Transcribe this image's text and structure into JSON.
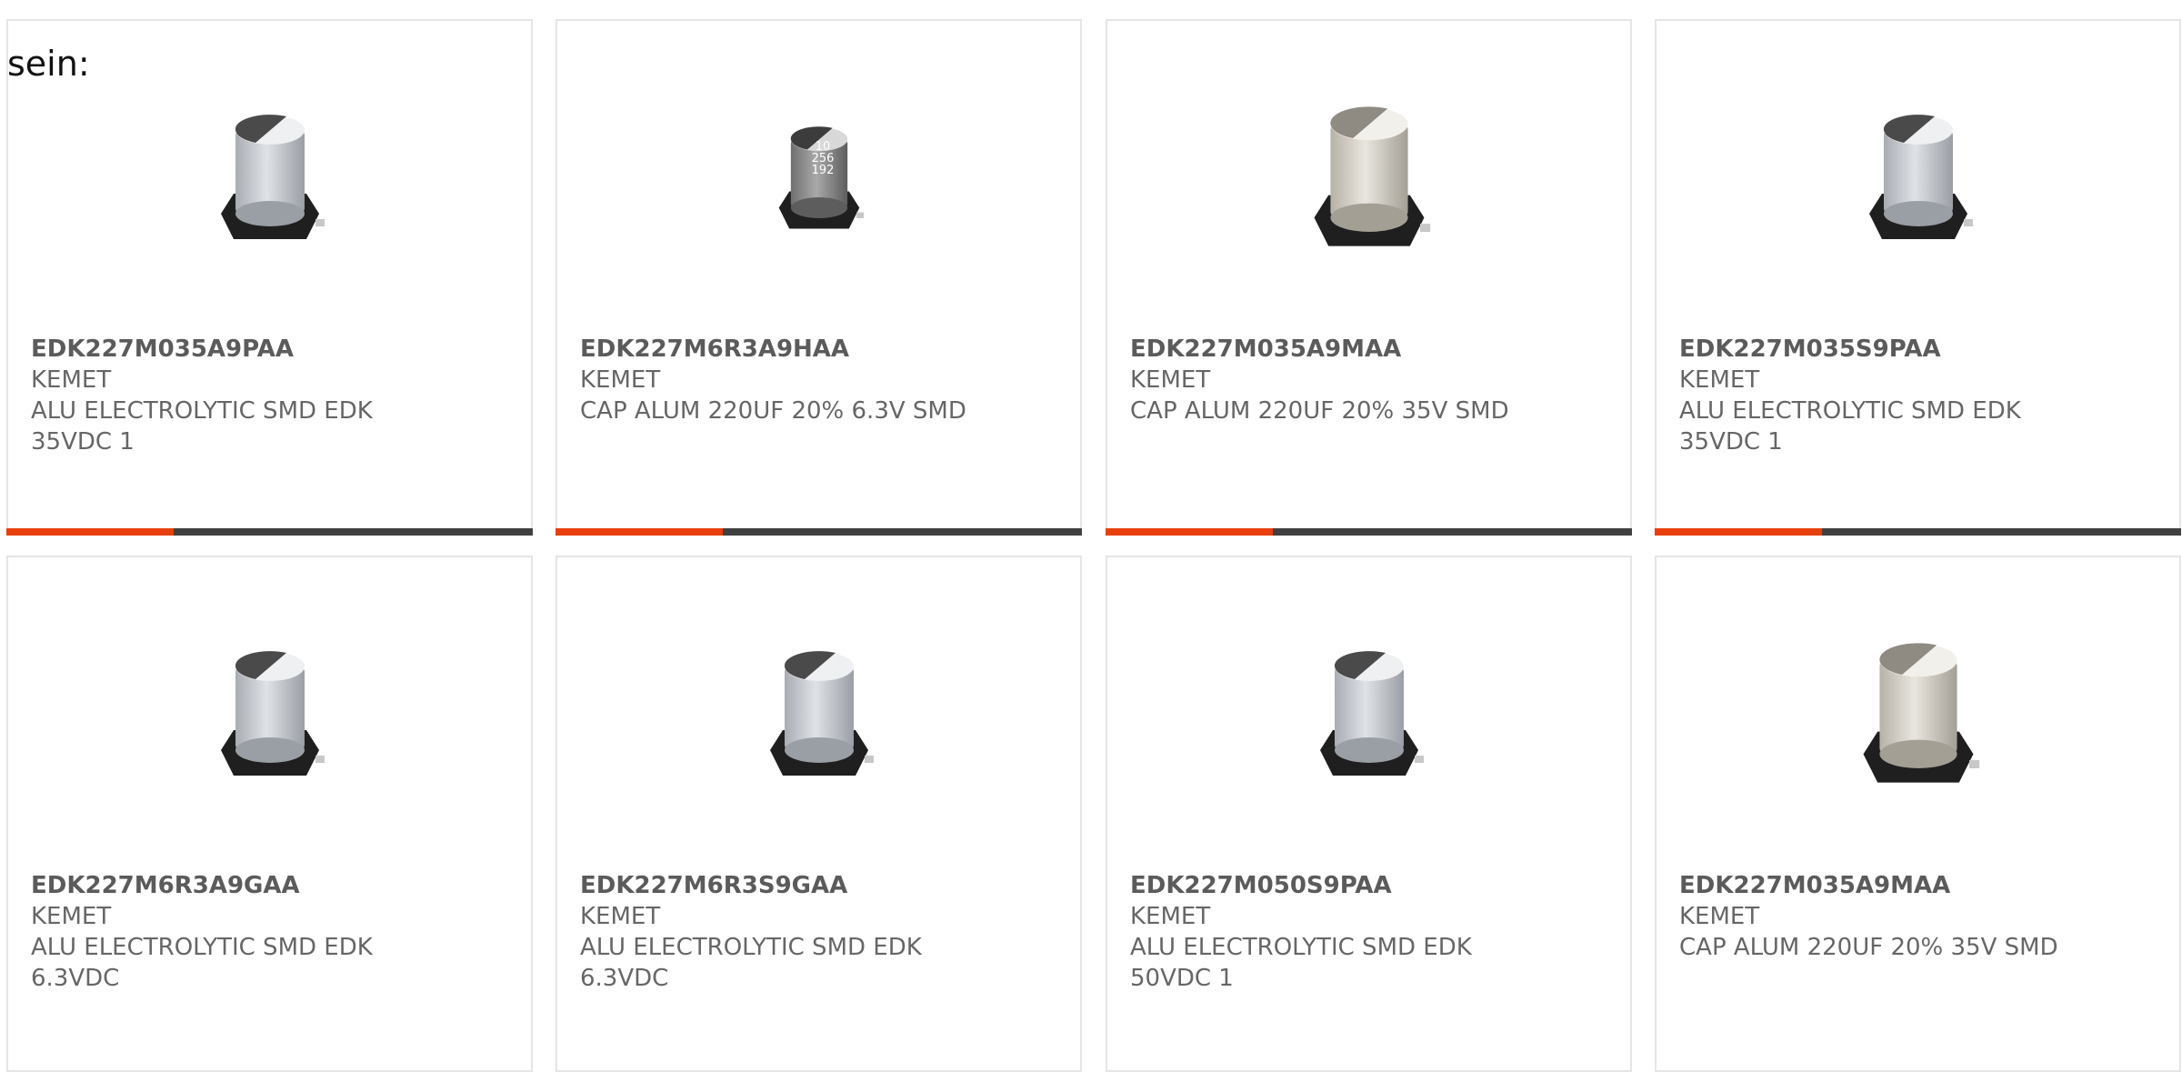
{
  "intro_text": "sein:",
  "colors": {
    "accent": "#e8400c",
    "bar_dark": "#404040",
    "text": "#666666",
    "border": "#e5e5e5"
  },
  "products": [
    {
      "part_number": "EDK227M035A9PAA",
      "manufacturer": "KEMET",
      "description": "ALU ELECTROLYTIC SMD EDK\n35VDC 1",
      "image": "capacitor-grey-icon"
    },
    {
      "part_number": "EDK227M6R3A9HAA",
      "manufacturer": "KEMET",
      "description": "CAP ALUM 220UF 20% 6.3V SMD",
      "image": "capacitor-dark-marked-icon",
      "image_marking": "10\n256\n192"
    },
    {
      "part_number": "EDK227M035A9MAA",
      "manufacturer": "KEMET",
      "description": "CAP ALUM 220UF 20% 35V SMD",
      "image": "capacitor-silver-icon"
    },
    {
      "part_number": "EDK227M035S9PAA",
      "manufacturer": "KEMET",
      "description": "ALU ELECTROLYTIC SMD EDK\n35VDC 1",
      "image": "capacitor-grey-icon"
    },
    {
      "part_number": "EDK227M6R3A9GAA",
      "manufacturer": "KEMET",
      "description": "ALU ELECTROLYTIC SMD EDK\n6.3VDC",
      "image": "capacitor-grey-icon"
    },
    {
      "part_number": "EDK227M6R3S9GAA",
      "manufacturer": "KEMET",
      "description": "ALU ELECTROLYTIC SMD EDK\n6.3VDC",
      "image": "capacitor-grey-icon"
    },
    {
      "part_number": "EDK227M050S9PAA",
      "manufacturer": "KEMET",
      "description": "ALU ELECTROLYTIC SMD EDK\n50VDC 1",
      "image": "capacitor-grey-icon"
    },
    {
      "part_number": "EDK227M035A9MAA",
      "manufacturer": "KEMET",
      "description": "CAP ALUM 220UF 20% 35V SMD",
      "image": "capacitor-silver-icon"
    }
  ]
}
